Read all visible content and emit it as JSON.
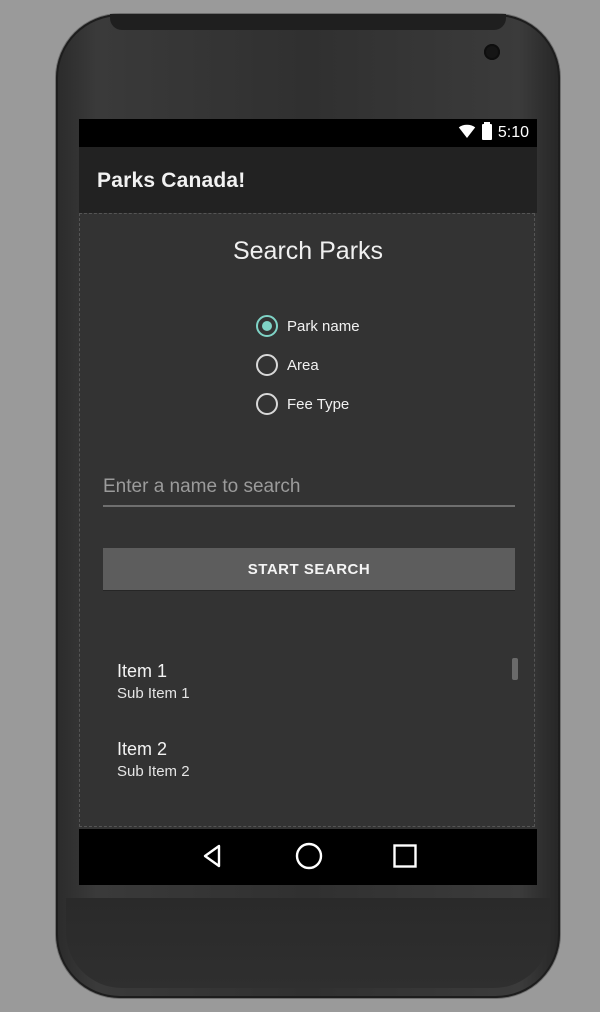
{
  "device": {
    "status_bar": {
      "time": "5:10",
      "icons": [
        "wifi-icon",
        "battery-icon"
      ]
    }
  },
  "app": {
    "title": "Parks Canada!"
  },
  "search": {
    "title": "Search Parks",
    "options": [
      {
        "label": "Park name",
        "selected": true
      },
      {
        "label": "Area",
        "selected": false
      },
      {
        "label": "Fee Type",
        "selected": false
      }
    ],
    "placeholder": "Enter a name to search",
    "button_label": "START SEARCH"
  },
  "results": [
    {
      "title": "Item 1",
      "subtitle": "Sub Item 1"
    },
    {
      "title": "Item 2",
      "subtitle": "Sub Item 2"
    }
  ],
  "navigation": {
    "buttons": [
      "back-icon",
      "home-icon",
      "recent-apps-icon"
    ]
  },
  "colors": {
    "accent": "#7fd3c6",
    "background": "#333333",
    "toolbar": "#222222",
    "button": "#5d5d5d"
  }
}
